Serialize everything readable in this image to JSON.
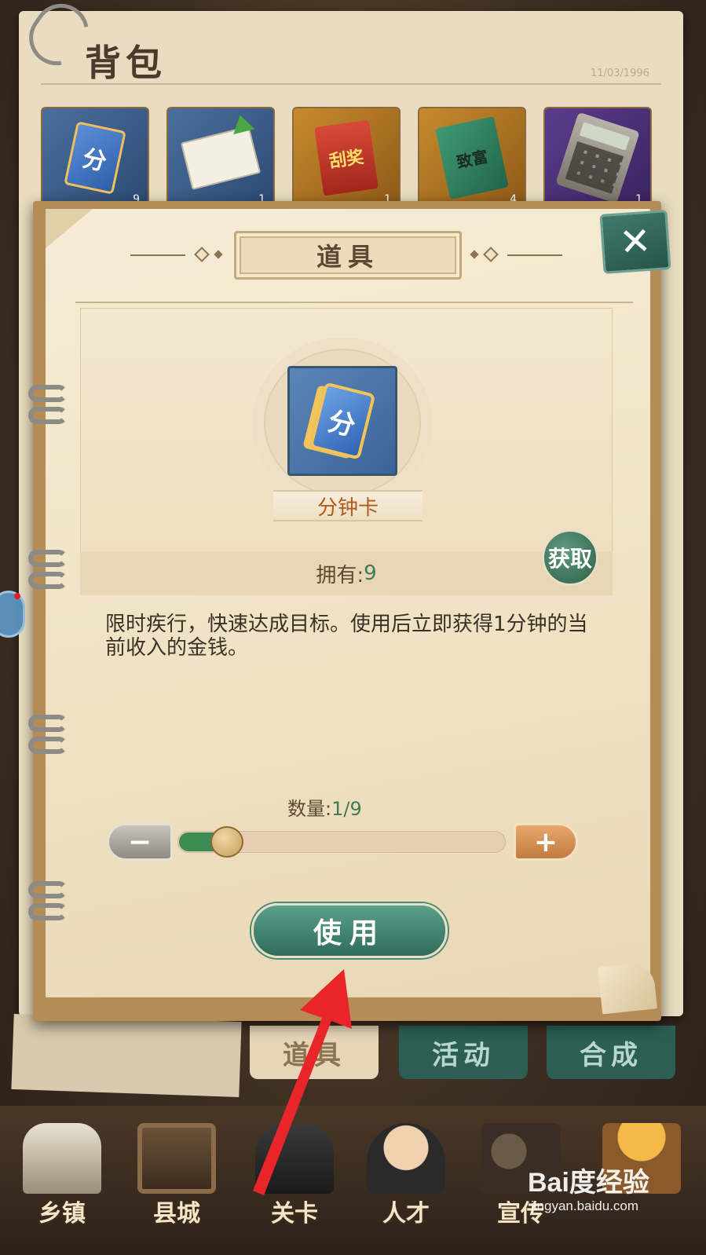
{
  "backpack": {
    "title": "背包",
    "date": "11/03/1996",
    "slots": [
      {
        "icon": "minute-card-icon",
        "glyph": "分",
        "count": "9"
      },
      {
        "icon": "upgrade-ticket-icon",
        "glyph": "",
        "count": "1"
      },
      {
        "icon": "scratch-ticket-icon",
        "glyph": "刮奖",
        "count": "1"
      },
      {
        "icon": "wealth-book-icon",
        "glyph": "致富",
        "count": "4"
      },
      {
        "icon": "calculator-icon",
        "glyph": "",
        "count": "1"
      }
    ]
  },
  "tabs": {
    "items": "道具",
    "activity": "活动",
    "craft": "合成"
  },
  "nav": [
    {
      "label": "乡镇",
      "icon": "house-icon"
    },
    {
      "label": "县城",
      "icon": "tv-icon"
    },
    {
      "label": "关卡",
      "icon": "sewing-machine-icon"
    },
    {
      "label": "人才",
      "icon": "person-icon"
    },
    {
      "label": "宣传",
      "icon": "camera-icon"
    },
    {
      "label": "",
      "icon": "bag-icon"
    }
  ],
  "dialog": {
    "title": "道具",
    "close_glyph": "✕",
    "item_glyph": "分",
    "item_name": "分钟卡",
    "own_label": "拥有:",
    "own_value": "9",
    "get_label": "获取",
    "description": "限时疾行，快速达成目标。使用后立即获得1分钟的当前收入的金钱。",
    "quantity_label": "数量:",
    "quantity_value": "1/9",
    "quantity_fraction": 0.111,
    "minus_glyph": "−",
    "plus_glyph": "+",
    "use_label": "使用"
  },
  "watermark": {
    "main": "Bai度经验",
    "sub": "jingyan.baidu.com"
  },
  "colors": {
    "accent_green": "#2f6d5b",
    "qty_green": "#3f7a5a",
    "item_name": "#b25a1b",
    "arrow_red": "#e8262a"
  }
}
